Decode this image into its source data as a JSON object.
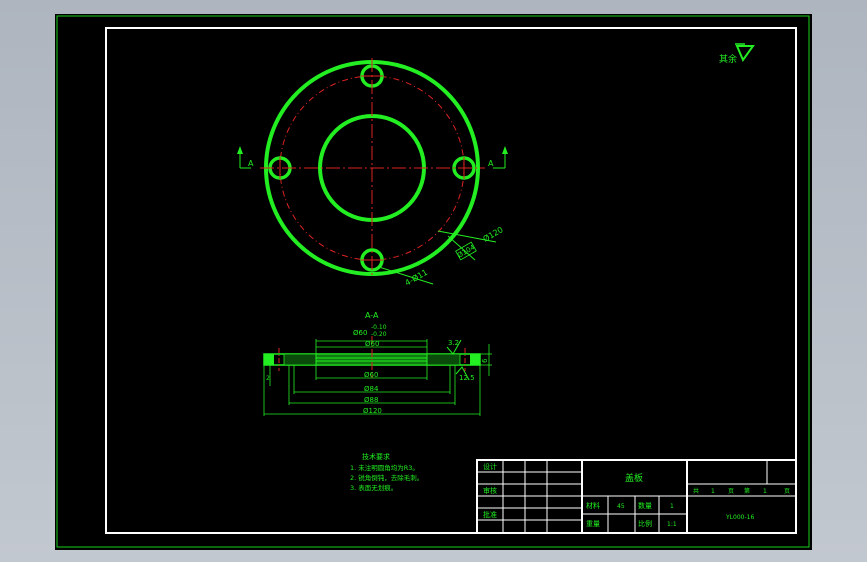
{
  "drawing": {
    "roughness_mark": "其余",
    "section_marker": "A",
    "section_title": "A-A",
    "dimensions": {
      "d120_hole_circle": "Ø120",
      "d104": "Ø104",
      "holes": "4-Ø11",
      "d60_tol": "Ø60",
      "tol_upper": "-0.10",
      "tol_lower": "-0.20",
      "d60_top": "Ø60",
      "d60_bottom": "Ø60",
      "d84": "Ø84",
      "d88": "Ø88",
      "d120_outer": "Ø120",
      "roughness_32": "3.2",
      "roughness_125": "12.5",
      "thickness_6": "6",
      "step_2": "2"
    },
    "notes": {
      "title": "技术要求",
      "lines": [
        "1. 未注明圆角均为R3。",
        "2. 锐角倒钝，去除毛刺。",
        "3. 表面无划痕。"
      ]
    }
  },
  "title_block": {
    "design": "设计",
    "review": "审核",
    "approve": "批准",
    "part_name": "盖板",
    "material_label": "材料",
    "material": "45",
    "qty_label": "数量",
    "qty": "1",
    "weight_label": "重量",
    "scale_label": "比例",
    "scale": "1:1",
    "sheets_total_label": "共",
    "sheets_total": "1",
    "sheet_no": "1",
    "page_label": "页",
    "sheet_label": "第",
    "drawing_no": "YL000-16"
  }
}
